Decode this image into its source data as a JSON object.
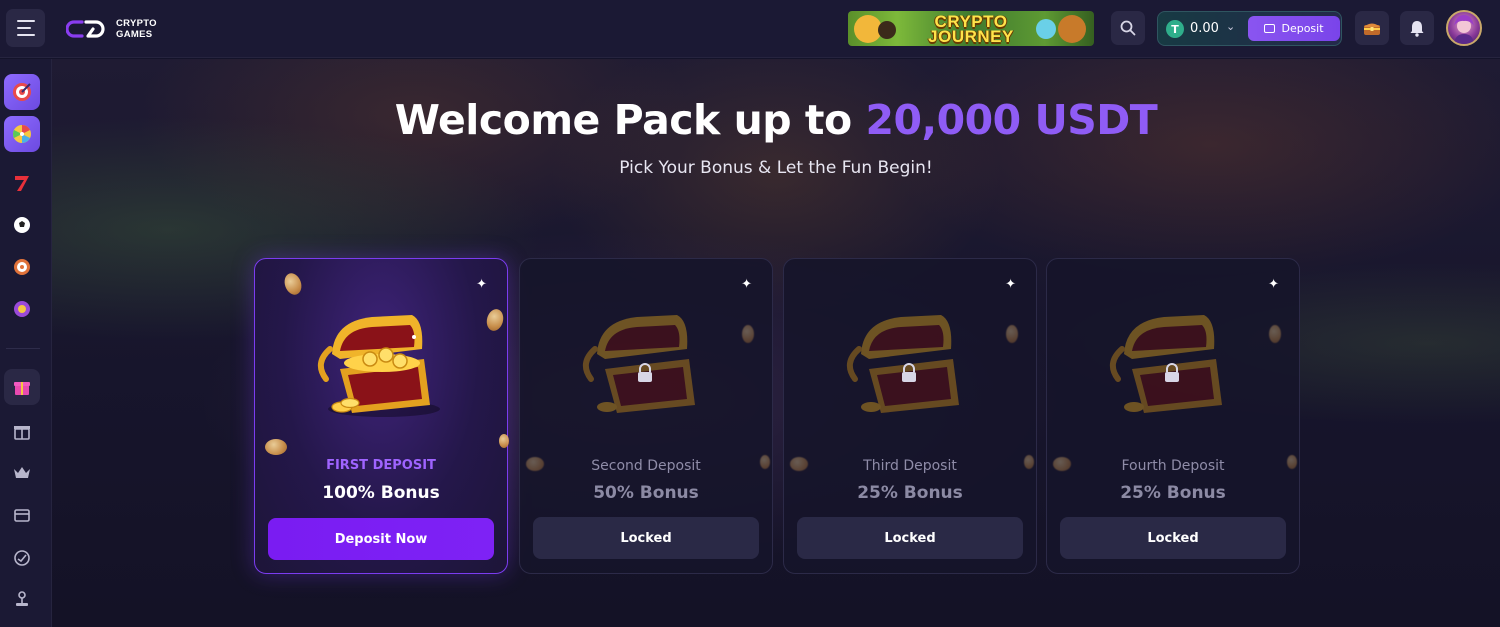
{
  "header": {
    "logo_text_line1": "CRYPTO",
    "logo_text_line2": "GAMES",
    "promo_banner": "CRYPTO JOURNEY",
    "wallet": {
      "currency_symbol": "T",
      "balance": "0.00",
      "deposit_label": "Deposit"
    },
    "icons": {
      "menu": "hamburger-icon",
      "search": "search-icon",
      "rewards": "treasure-chest-icon",
      "notifications": "bell-icon",
      "avatar": "user-avatar"
    }
  },
  "sidebar": {
    "items": [
      {
        "icon": "target-icon"
      },
      {
        "icon": "wheel-of-fortune-icon"
      },
      {
        "icon": "slot-seven-icon"
      },
      {
        "icon": "soccer-ball-icon"
      },
      {
        "icon": "roulette-icon"
      },
      {
        "icon": "pinball-icon"
      },
      {
        "icon": "gift-box-icon"
      },
      {
        "icon": "gift-icon"
      },
      {
        "icon": "crown-icon"
      },
      {
        "icon": "ticket-icon"
      },
      {
        "icon": "headset-support-icon"
      },
      {
        "icon": "joystick-icon"
      }
    ]
  },
  "hero": {
    "headline_main": "Welcome Pack up to",
    "headline_accent": "20,000 USDT",
    "subline": "Pick Your Bonus & Let the Fun Begin!"
  },
  "cards": [
    {
      "title": "FIRST DEPOSIT",
      "bonus": "100% Bonus",
      "button": "Deposit Now",
      "locked": false
    },
    {
      "title": "Second Deposit",
      "bonus": "50% Bonus",
      "button": "Locked",
      "locked": true
    },
    {
      "title": "Third Deposit",
      "bonus": "25% Bonus",
      "button": "Locked",
      "locked": true
    },
    {
      "title": "Fourth Deposit",
      "bonus": "25% Bonus",
      "button": "Locked",
      "locked": true
    }
  ],
  "colors": {
    "accent_purple": "#8f5cf5",
    "button_purple": "#7a1cf2",
    "background": "#14132a",
    "card_locked": "#2a2946"
  }
}
